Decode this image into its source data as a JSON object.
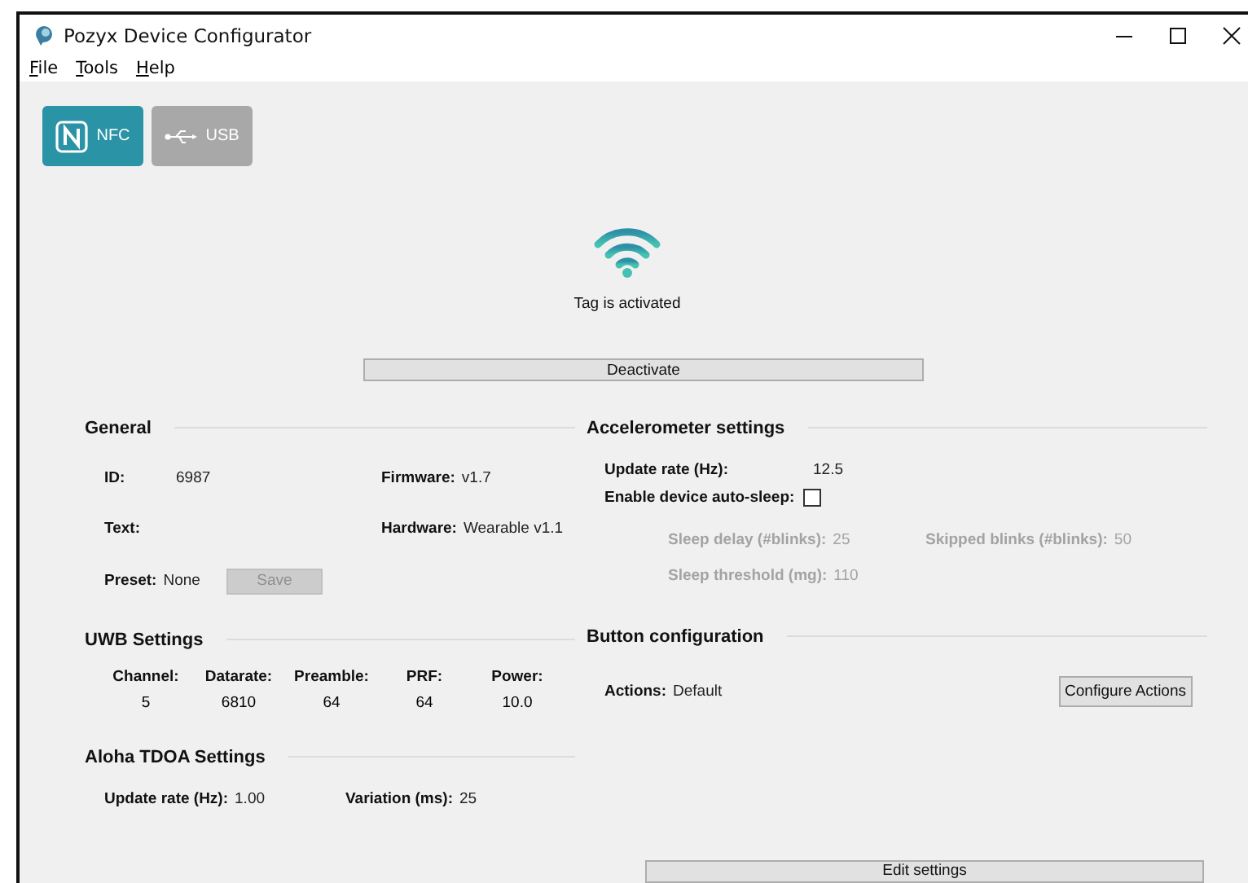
{
  "window": {
    "title": "Pozyx Device Configurator"
  },
  "menu": [
    {
      "label": "File"
    },
    {
      "label": "Tools"
    },
    {
      "label": "Help"
    }
  ],
  "connection_modes": [
    {
      "kind": "nfc",
      "label": "NFC",
      "selected": true
    },
    {
      "kind": "usb",
      "label": "USB",
      "selected": false
    }
  ],
  "status": {
    "text": "Tag is activated",
    "action": "Deactivate"
  },
  "general": {
    "title": "General",
    "fields": [
      {
        "label": "ID:",
        "value": "6987"
      },
      {
        "label": "Firmware:",
        "value": "v1.7"
      },
      {
        "label": "Text:"
      },
      {
        "label": "Hardware:",
        "value": "Wearable v1.1"
      },
      {
        "label": "Preset:",
        "value": "None"
      }
    ],
    "save_button": {
      "label": "Save",
      "disabled": true
    }
  },
  "uwb": {
    "title": "UWB Settings",
    "columns": [
      {
        "label": "Channel:",
        "value": "5"
      },
      {
        "label": "Datarate:",
        "value": "6810"
      },
      {
        "label": "Preamble:",
        "value": "64"
      },
      {
        "label": "PRF:",
        "value": "64"
      },
      {
        "label": "Power:",
        "value": "10.0"
      }
    ]
  },
  "aloha_tdoa": {
    "title": "Aloha TDOA Settings",
    "fields": [
      {
        "label": "Update rate (Hz):",
        "value": "1.00"
      },
      {
        "label": "Variation (ms):",
        "value": "25"
      }
    ]
  },
  "accelerometer": {
    "title": "Accelerometer settings",
    "update_rate": {
      "label": "Update rate (Hz):",
      "value": "12.5"
    },
    "auto_sleep": {
      "label": "Enable device auto-sleep:",
      "checked": false
    },
    "sleep_fields": [
      {
        "label": "Sleep delay (#blinks):",
        "value": "25"
      },
      {
        "label": "Skipped blinks (#blinks):",
        "value": "50"
      },
      {
        "label": "Sleep threshold (mg):",
        "value": "110"
      }
    ]
  },
  "button_configuration": {
    "title": "Button configuration",
    "actions": {
      "label": "Actions:",
      "value": "Default"
    },
    "button": "Configure Actions"
  },
  "edit_button": "Edit settings"
}
